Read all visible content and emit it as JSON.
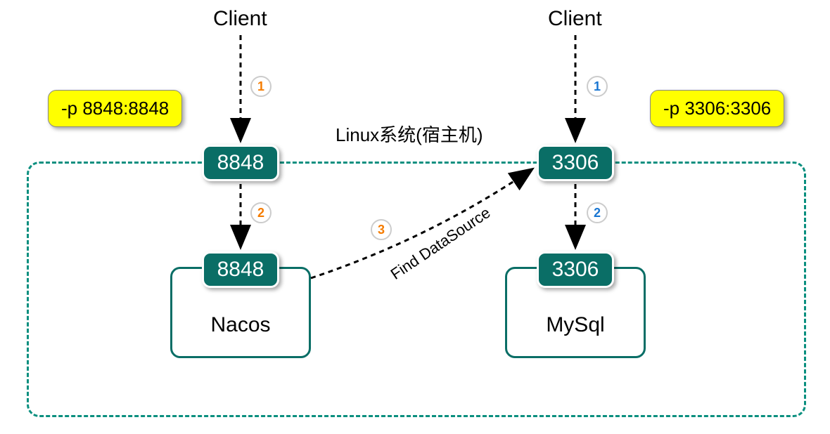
{
  "clients": {
    "left_label": "Client",
    "right_label": "Client"
  },
  "port_mappings": {
    "left_pill": "-p 8848:8848",
    "right_pill": "-p 3306:3306"
  },
  "system_label": "Linux系统(宿主机)",
  "host_ports": {
    "left": "8848",
    "right": "3306"
  },
  "container_ports": {
    "left": "8848",
    "right": "3306"
  },
  "containers": {
    "left_name": "Nacos",
    "right_name": "MySql"
  },
  "find_datasource_label": "Find DataSource",
  "steps": {
    "left_1": "1",
    "left_2": "2",
    "center_3": "3",
    "right_1": "1",
    "right_2": "2"
  }
}
